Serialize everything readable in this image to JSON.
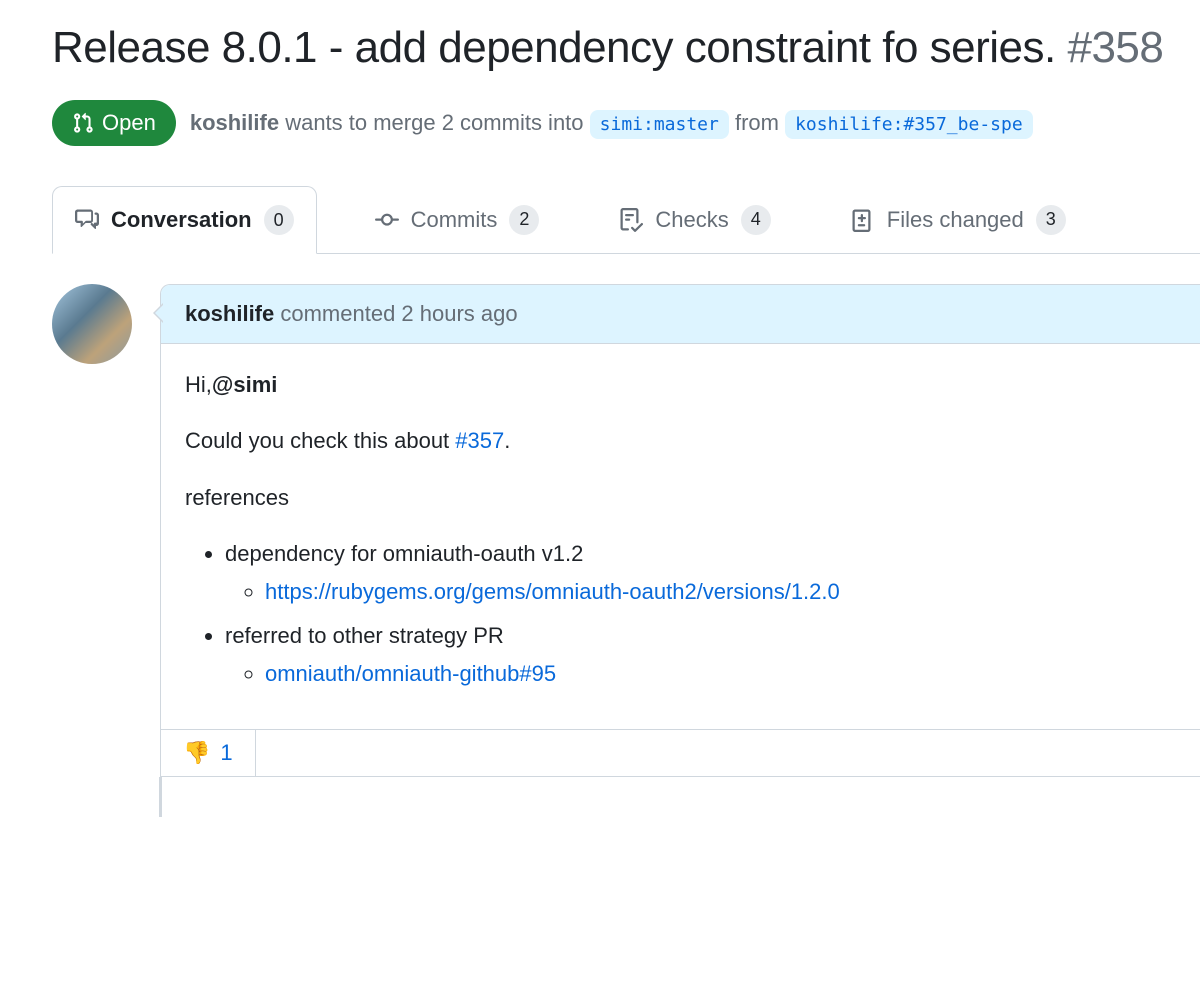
{
  "pr": {
    "title": "Release 8.0.1 - add dependency constraint fo series.",
    "number": "#358",
    "state": "Open",
    "author": "koshilife",
    "merge_text_1": " wants to merge 2 commits into ",
    "base_branch": "simi:master",
    "merge_text_2": " from ",
    "head_branch": "koshilife:#357_be-spe"
  },
  "tabs": {
    "conversation": {
      "label": "Conversation",
      "count": "0"
    },
    "commits": {
      "label": "Commits",
      "count": "2"
    },
    "checks": {
      "label": "Checks",
      "count": "4"
    },
    "files": {
      "label": "Files changed",
      "count": "3"
    }
  },
  "comment": {
    "author": "koshilife",
    "time_text": " commented 2 hours ago",
    "greeting_prefix": "Hi,",
    "mention": "@simi",
    "line2_prefix": "Could you check this about ",
    "line2_issue": "#357",
    "line2_suffix": ".",
    "references_label": "references",
    "ref1_label": "dependency for omniauth-oauth v1.2",
    "ref1_link": "https://rubygems.org/gems/omniauth-oauth2/versions/1.2.0",
    "ref2_label": "referred to other strategy PR",
    "ref2_link": "omniauth/omniauth-github#95"
  },
  "reaction": {
    "emoji": "👎",
    "count": "1"
  }
}
